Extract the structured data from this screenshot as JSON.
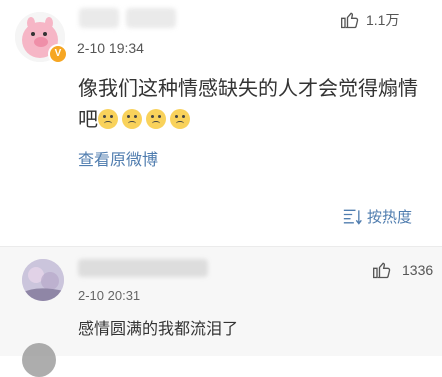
{
  "post": {
    "time": "2-10 19:34",
    "likes": "1.1万",
    "content_text": "像我们这种情感缺失的人才会觉得煽情吧",
    "emoji_count": 4,
    "view_original": "查看原微博",
    "sort_label": "按热度"
  },
  "comment": {
    "time": "2-10 20:31",
    "likes": "1336",
    "text": "感情圆满的我都流泪了"
  }
}
